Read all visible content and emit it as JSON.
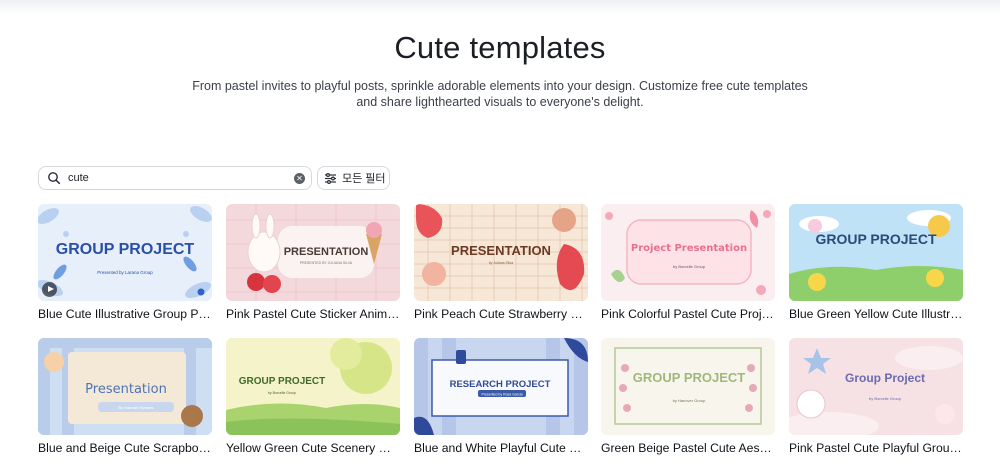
{
  "header": {
    "title": "Cute templates",
    "description": "From pastel invites to playful posts, sprinkle adorable elements into your design. Customize free cute templates and share lighthearted visuals to everyone's delight."
  },
  "search": {
    "value": "cute",
    "icon": "search-icon"
  },
  "filter": {
    "label": "모든 필터",
    "icon": "sliders-icon"
  },
  "templates": [
    {
      "title": "Blue Cute Illustrative Group Project Presentation",
      "thumb_heading": "GROUP PROJECT",
      "thumb_sub": "Presented by Larana Group"
    },
    {
      "title": "Pink Pastel Cute Sticker Animated Presentation",
      "thumb_heading": "PRESENTATION",
      "thumb_sub": "PRESENTED BY JULIANA SILVA"
    },
    {
      "title": "Pink Peach Cute Strawberry Presentation",
      "thumb_heading": "PRESENTATION",
      "thumb_sub": "by Juliana Silva"
    },
    {
      "title": "Pink Colorful Pastel Cute Project Presentation",
      "thumb_heading": "Project Presentation",
      "thumb_sub": "by Borcelle Group"
    },
    {
      "title": "Blue Green Yellow Cute Illustrative Group Project",
      "thumb_heading": "GROUP PROJECT",
      "thumb_sub": ""
    },
    {
      "title": "Blue and Beige Cute Scrapbook Presentation",
      "thumb_heading": "Presentation",
      "thumb_sub": "By Hannah Morales"
    },
    {
      "title": "Yellow Green Cute Scenery Group Project",
      "thumb_heading": "GROUP PROJECT",
      "thumb_sub": "by Borcelle Group"
    },
    {
      "title": "Blue and White Playful Cute Research Project",
      "thumb_heading": "RESEARCH PROJECT",
      "thumb_sub": "Presented by Rosa Garcia"
    },
    {
      "title": "Green Beige Pastel Cute Aesthetic Group Project",
      "thumb_heading": "GROUP PROJECT",
      "thumb_sub": "by Hanover Group"
    },
    {
      "title": "Pink Pastel Cute Playful Group Project",
      "thumb_heading": "Group Project",
      "thumb_sub": "by Borcelle Group"
    }
  ],
  "colors": {
    "accent": "#7d2ae8",
    "text": "#0e1318",
    "border": "#d5d8dc"
  }
}
